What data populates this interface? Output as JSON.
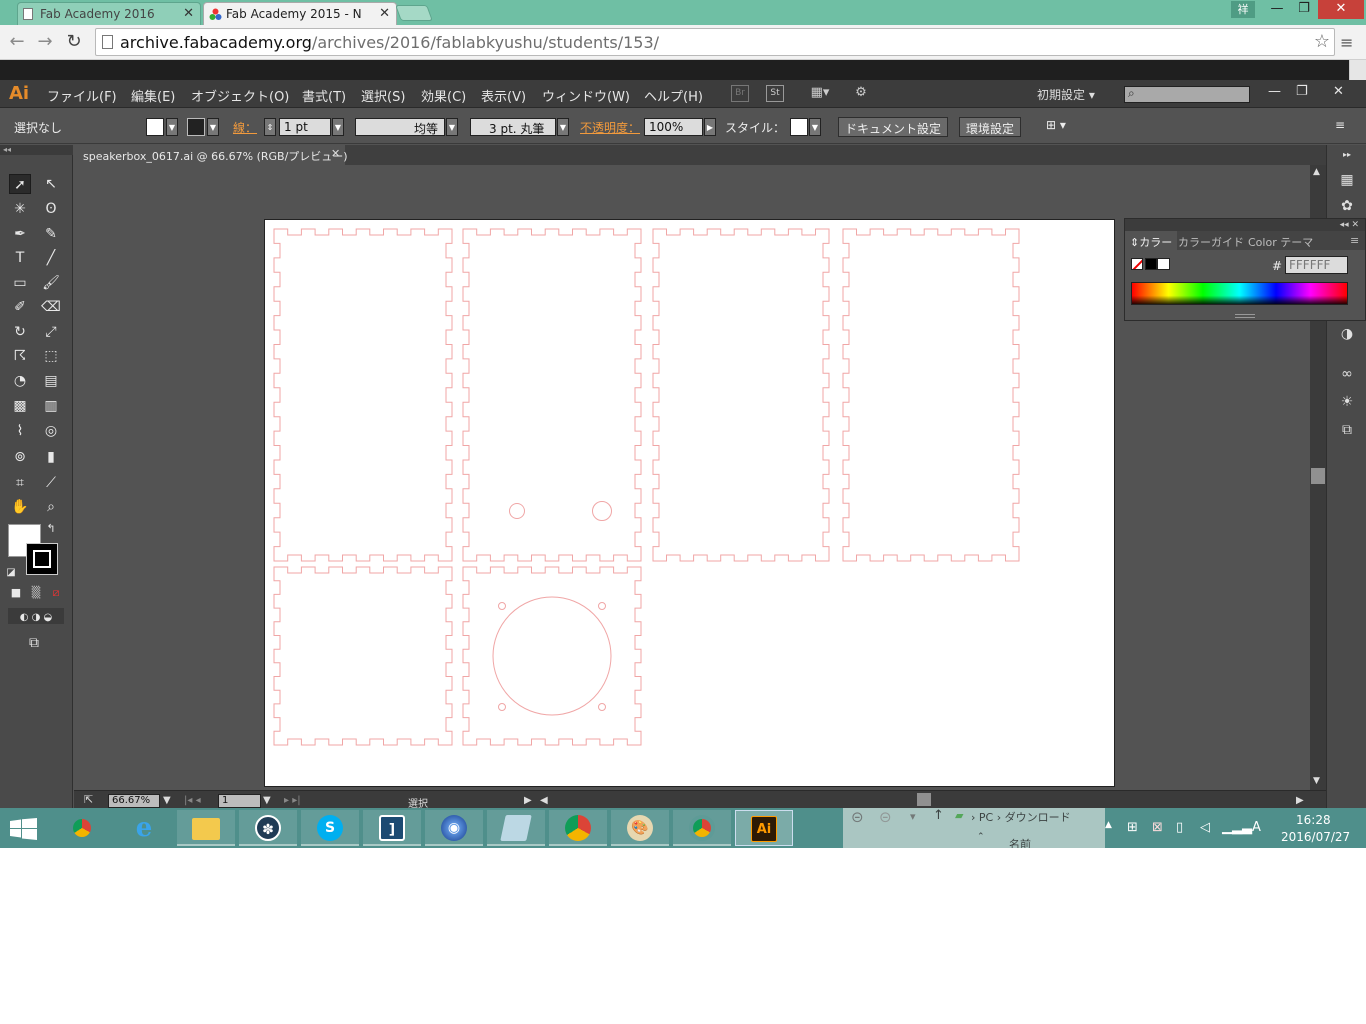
{
  "browser": {
    "tabs": [
      {
        "title": "Fab Academy 2016",
        "active": false
      },
      {
        "title": "Fab Academy 2015 - N",
        "active": true
      }
    ],
    "ime_indicator": "祥",
    "url": {
      "host": "archive.fabacademy.org",
      "path": "/archives/2016/fablabkyushu/students/153/"
    }
  },
  "illustrator": {
    "logo": "Ai",
    "menu": [
      "ファイル(F)",
      "編集(E)",
      "オブジェクト(O)",
      "書式(T)",
      "選択(S)",
      "効果(C)",
      "表示(V)",
      "ウィンドウ(W)",
      "ヘルプ(H)"
    ],
    "menu_icons": [
      "Br",
      "St"
    ],
    "workspace": "初期設定",
    "control": {
      "selection": "選択なし",
      "stroke_label": "線：",
      "stroke_weight": "1 pt",
      "stroke_profile": "均等",
      "brush": "3 pt. 丸筆",
      "opacity_label": "不透明度：",
      "opacity": "100%",
      "style_label": "スタイル：",
      "doc_setup": "ドキュメント設定",
      "prefs": "環境設定"
    },
    "document_tab": "speakerbox_0617.ai @ 66.67% (RGB/プレビュー)",
    "status": {
      "zoom": "66.67%",
      "artboard_num": "1",
      "tool": "選択"
    },
    "color_panel": {
      "tabs": [
        "カラー",
        "カラーガイド",
        "Color テーマ"
      ],
      "active_tab": "カラー",
      "hex": "FFFFFF"
    },
    "art_stroke_color": "#f0a6a6"
  },
  "taskbar": {
    "explorer_path": [
      "PC",
      "ダウンロード"
    ],
    "explorer_column": "名前",
    "time": "16:28",
    "date": "2016/07/27"
  }
}
